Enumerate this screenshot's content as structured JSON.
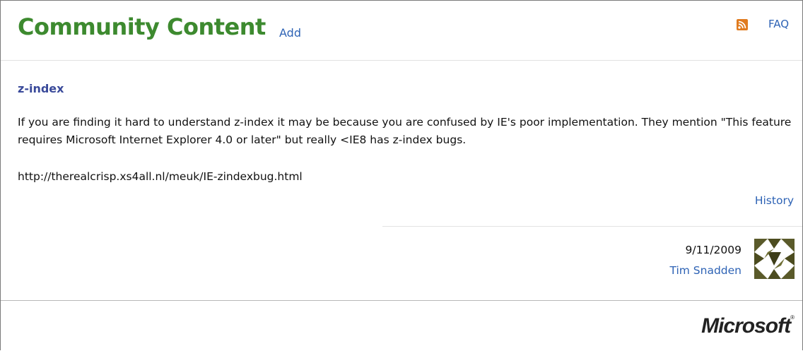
{
  "header": {
    "title": "Community Content",
    "add_label": "Add",
    "faq_label": "FAQ",
    "rss_icon": "rss-feed-icon",
    "rss_color": "#e07b1f"
  },
  "entry": {
    "title": "z-index",
    "body": "If you are finding it hard to understand z-index it may be because you are confused by IE's poor implementation. They mention \"This feature requires Microsoft Internet Explorer 4.0 or later\" but really <IE8 has z-index bugs.",
    "url": "http://therealcrisp.xs4all.nl/meuk/IE-zindexbug.html",
    "history_label": "History"
  },
  "post": {
    "date": "9/11/2009",
    "author": "Tim Snadden",
    "avatar_icon": "user-avatar-icon"
  },
  "footer": {
    "logo_text": "Microsoft",
    "logo_mark": "®"
  },
  "colors": {
    "title_green": "#3d8a2f",
    "link_blue": "#2e63b5",
    "entry_title": "#3a4a9a"
  }
}
